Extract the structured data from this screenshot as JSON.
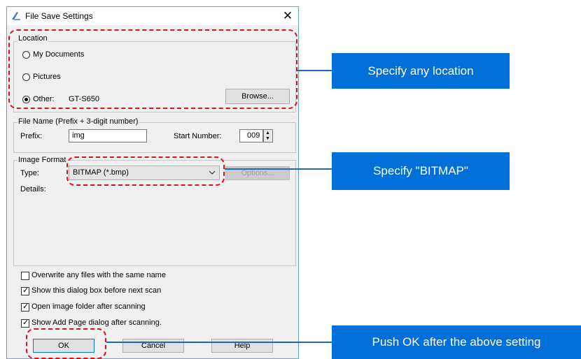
{
  "dialog": {
    "title": "File Save Settings",
    "close_glyph": "✕",
    "location": {
      "legend": "Location",
      "options": [
        "My Documents",
        "Pictures",
        "Other:"
      ],
      "selected": "Other:",
      "other_value": "GT-S650",
      "browse_label": "Browse..."
    },
    "file_name": {
      "legend": "File Name (Prefix + 3-digit number)",
      "prefix_label": "Prefix:",
      "prefix_value": "img",
      "start_label": "Start Number:",
      "start_value": "009"
    },
    "image_format": {
      "legend": "Image Format",
      "type_label": "Type:",
      "type_value": "BITMAP (*.bmp)",
      "options_label": "Options...",
      "details_label": "Details:"
    },
    "checkboxes": [
      {
        "label": "Overwrite any files with the same name",
        "checked": false
      },
      {
        "label": "Show this dialog box before next scan",
        "checked": true
      },
      {
        "label": "Open image folder after scanning",
        "checked": true
      },
      {
        "label": "Show Add Page dialog after scanning.",
        "checked": true
      }
    ],
    "buttons": {
      "ok": "OK",
      "cancel": "Cancel",
      "help": "Help"
    }
  },
  "callouts": {
    "location": "Specify any location",
    "bitmap": "Specify \"BITMAP\"",
    "ok": "Push OK after the above setting"
  },
  "colors": {
    "callout": "#0070d8",
    "highlight": "#d9121b",
    "connector": "#1a67c4"
  }
}
